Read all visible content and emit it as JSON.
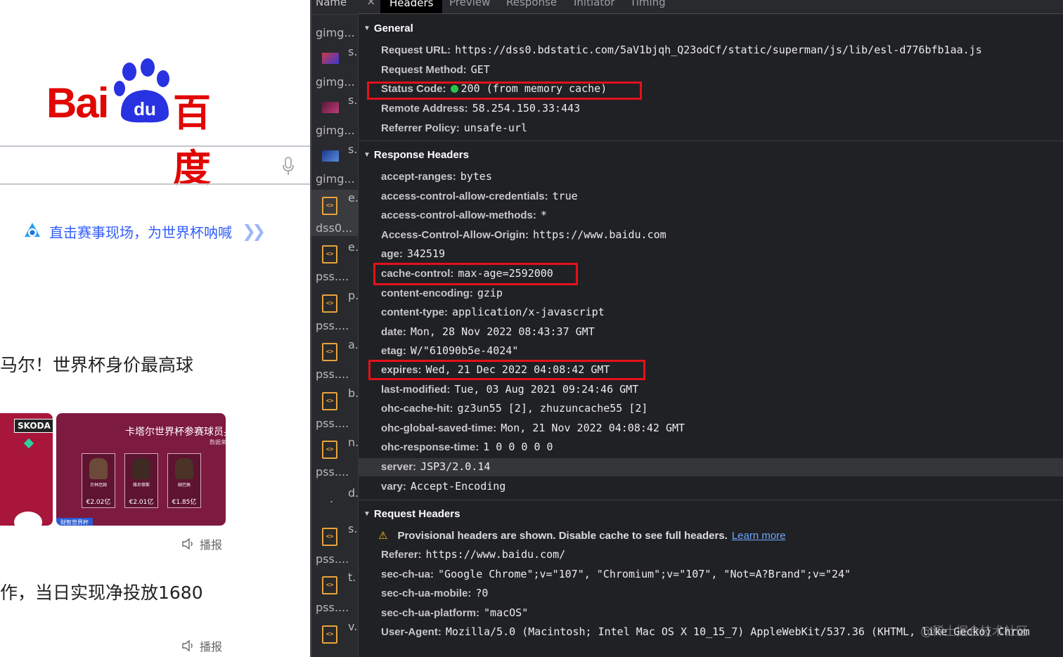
{
  "baidu": {
    "logo_latin": "Bai",
    "logo_du": "du",
    "logo_cn": "百度",
    "promo_text": "直击赛事现场，为世界杯呐喊",
    "news1_title": "马尔！世界杯身价最高球",
    "card_brand": "SKODA",
    "card_title": "卡塔尔世界杯参赛球员身",
    "card_source": "数据来源：足球天",
    "players": [
      {
        "name": "贝林厄姆",
        "value": "€2.02亿"
      },
      {
        "name": "维尼修斯",
        "value": "€2.01亿"
      },
      {
        "name": "姆巴佩",
        "value": "€1.85亿"
      }
    ],
    "card_footer": "财智世界杯",
    "play_label": "播报",
    "news2_title": "作，当日实现净投放1680",
    "play_label2": "播报"
  },
  "devtools": {
    "list_header": "Name",
    "requests": [
      {
        "name": "gimg...",
        "letter": "s."
      },
      {
        "name": "gimg...",
        "letter": "s."
      },
      {
        "name": "gimg...",
        "letter": "s."
      },
      {
        "name": "gimg...",
        "letter": "e."
      },
      {
        "name": "dss0...",
        "letter": "e."
      },
      {
        "name": "pss....",
        "letter": "p."
      },
      {
        "name": "pss....",
        "letter": "a."
      },
      {
        "name": "pss....",
        "letter": "b."
      },
      {
        "name": "pss....",
        "letter": "n."
      },
      {
        "name": "pss....",
        "letter": "d."
      },
      {
        "name": ".",
        "letter": "s."
      },
      {
        "name": "pss....",
        "letter": "t."
      },
      {
        "name": "pss....",
        "letter": "v."
      }
    ],
    "tabs": [
      "Headers",
      "Preview",
      "Response",
      "Initiator",
      "Timing"
    ],
    "active_tab": "Headers",
    "general": {
      "title": "General",
      "request_url_key": "Request URL:",
      "request_url": "https://dss0.bdstatic.com/5aV1bjqh_Q23odCf/static/superman/js/lib/esl-d776bfb1aa.js",
      "method_key": "Request Method:",
      "method": "GET",
      "status_key": "Status Code:",
      "status": "200  (from memory cache)",
      "remote_key": "Remote Address:",
      "remote": "58.254.150.33:443",
      "referrer_key": "Referrer Policy:",
      "referrer": "unsafe-url"
    },
    "response_headers": {
      "title": "Response Headers",
      "rows": [
        {
          "k": "accept-ranges:",
          "v": "bytes"
        },
        {
          "k": "access-control-allow-credentials:",
          "v": "true"
        },
        {
          "k": "access-control-allow-methods:",
          "v": "*"
        },
        {
          "k": "Access-Control-Allow-Origin:",
          "v": "https://www.baidu.com"
        },
        {
          "k": "age:",
          "v": "342519"
        },
        {
          "k": "cache-control:",
          "v": "max-age=2592000"
        },
        {
          "k": "content-encoding:",
          "v": "gzip"
        },
        {
          "k": "content-type:",
          "v": "application/x-javascript"
        },
        {
          "k": "date:",
          "v": "Mon, 28 Nov 2022 08:43:37 GMT"
        },
        {
          "k": "etag:",
          "v": "W/\"61090b5e-4024\""
        },
        {
          "k": "expires:",
          "v": "Wed, 21 Dec 2022 04:08:42 GMT"
        },
        {
          "k": "last-modified:",
          "v": "Tue, 03 Aug 2021 09:24:46 GMT"
        },
        {
          "k": "ohc-cache-hit:",
          "v": "gz3un55 [2], zhuzuncache55 [2]"
        },
        {
          "k": "ohc-global-saved-time:",
          "v": "Mon, 21 Nov 2022 04:08:42 GMT"
        },
        {
          "k": "ohc-response-time:",
          "v": "1 0 0 0 0 0"
        },
        {
          "k": "server:",
          "v": "JSP3/2.0.14"
        },
        {
          "k": "vary:",
          "v": "Accept-Encoding"
        }
      ]
    },
    "request_headers": {
      "title": "Request Headers",
      "warning": "Provisional headers are shown. Disable cache to see full headers.",
      "learn_more": "Learn more",
      "rows": [
        {
          "k": "Referer:",
          "v": "https://www.baidu.com/"
        },
        {
          "k": "sec-ch-ua:",
          "v": "\"Google Chrome\";v=\"107\", \"Chromium\";v=\"107\", \"Not=A?Brand\";v=\"24\""
        },
        {
          "k": "sec-ch-ua-mobile:",
          "v": "?0"
        },
        {
          "k": "sec-ch-ua-platform:",
          "v": "\"macOS\""
        },
        {
          "k": "User-Agent:",
          "v": "Mozilla/5.0 (Macintosh; Intel Mac OS X 10_15_7) AppleWebKit/537.36 (KHTML, like Gecko) Chrom"
        }
      ]
    },
    "watermark": "@稀土掘金技术社区",
    "colors": {
      "panel_bg": "#202124",
      "highlight_red": "#e3111b",
      "status_green": "#29c54a",
      "baidu_red": "#e10601",
      "link_blue": "#315efb"
    }
  }
}
